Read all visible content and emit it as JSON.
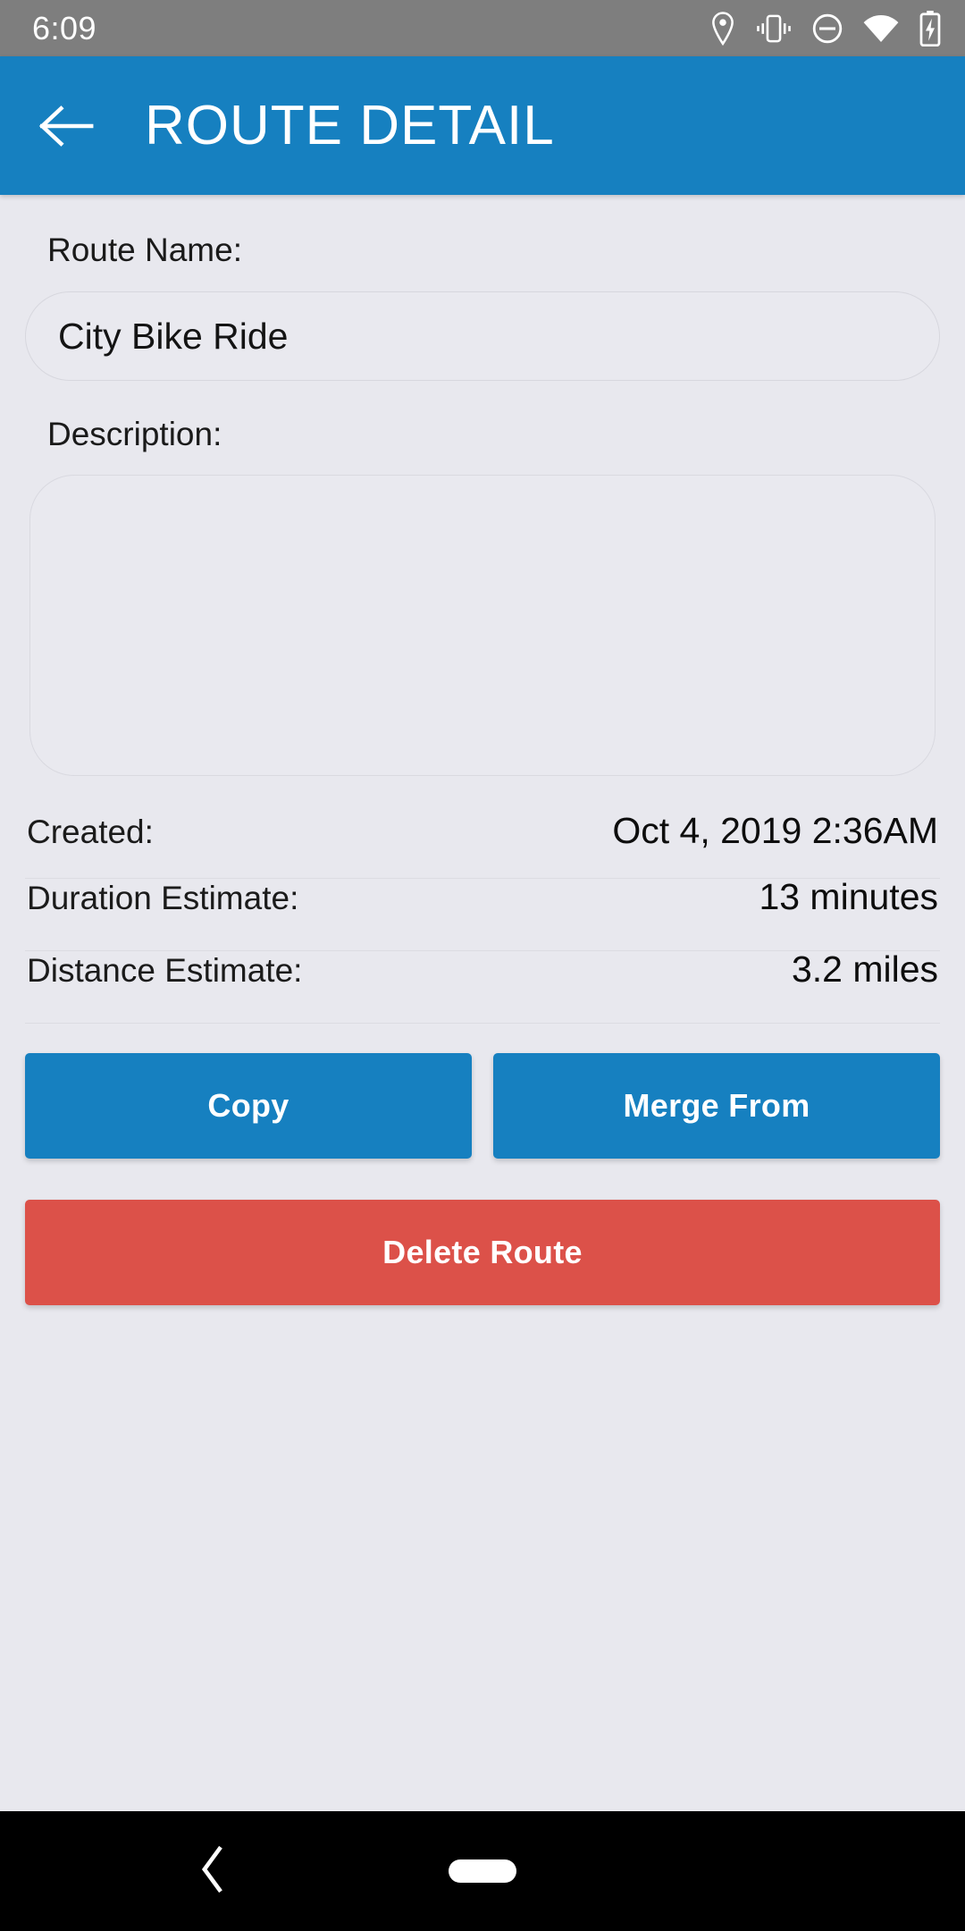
{
  "status_bar": {
    "time": "6:09",
    "icons": [
      "location-pin-icon",
      "vibrate-icon",
      "do-not-disturb-icon",
      "wifi-icon",
      "battery-charging-icon"
    ]
  },
  "app_bar": {
    "back_icon": "back-arrow-icon",
    "title": "ROUTE DETAIL",
    "background_color": "#1680c0"
  },
  "form": {
    "name_label": "Route Name:",
    "name_value": "City Bike Ride",
    "name_placeholder": "",
    "description_label": "Description:",
    "description_value": "",
    "description_placeholder": ""
  },
  "details": [
    {
      "key": "Created:",
      "value": "Oct 4, 2019 2:36AM"
    },
    {
      "key": "Duration Estimate:",
      "value": "13 minutes"
    },
    {
      "key": "Distance Estimate:",
      "value": "3.2 miles"
    }
  ],
  "actions": {
    "copy_label": "Copy",
    "merge_label": "Merge From",
    "delete_label": "Delete Route",
    "primary_color": "#1680c0",
    "danger_color": "#dc5149"
  },
  "nav_bar": {
    "back_icon": "nav-back-chevron-icon",
    "home_icon": "nav-home-pill-icon"
  }
}
